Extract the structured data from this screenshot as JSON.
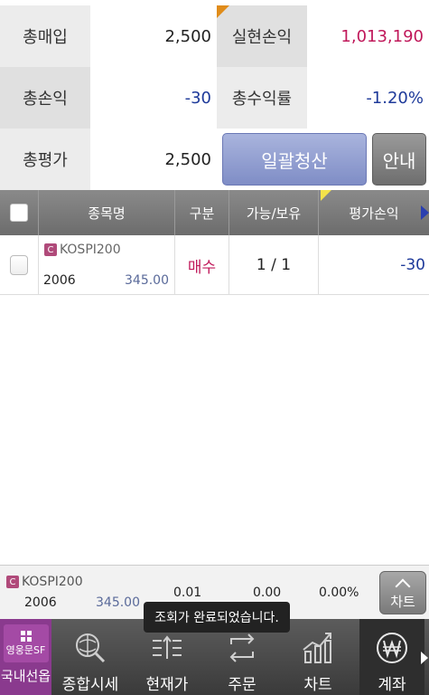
{
  "summary": {
    "total_buy_label": "총매입",
    "total_buy_value": "2,500",
    "realized_pl_label": "실현손익",
    "realized_pl_value": "1,013,190",
    "total_pl_label": "총손익",
    "total_pl_value": "-30",
    "total_return_label": "총수익률",
    "total_return_value": "-1.20%",
    "total_eval_label": "총평가",
    "total_eval_value": "2,500",
    "liquidate_button": "일괄청산",
    "info_button": "안내"
  },
  "table": {
    "headers": [
      "종목명",
      "구분",
      "가능/보유",
      "평가손익"
    ],
    "rows": [
      {
        "badge": "C",
        "name": "KOSPI200",
        "code": "2006",
        "price": "345.00",
        "type": "매수",
        "avail_hold": "1 / 1",
        "pl": "-30"
      }
    ]
  },
  "bottom_info": {
    "badge": "C",
    "name": "KOSPI200",
    "code": "2006",
    "price": "345.00",
    "v1": "0.01",
    "v2": "0.00",
    "v3": "0.00%",
    "chart_button": "차트"
  },
  "toast": "조회가 완료되었습니다.",
  "nav": {
    "items": [
      {
        "label": "국내선옵",
        "sublabel": "영웅문SF"
      },
      {
        "label": "종합시세"
      },
      {
        "label": "현재가"
      },
      {
        "label": "주문"
      },
      {
        "label": "차트"
      },
      {
        "label": "계좌"
      }
    ]
  },
  "colors": {
    "red": "#c0185a",
    "blue": "#1e3a9a",
    "accent_button": "#8a96cc",
    "nav_active_left": "#8a3a8e"
  }
}
